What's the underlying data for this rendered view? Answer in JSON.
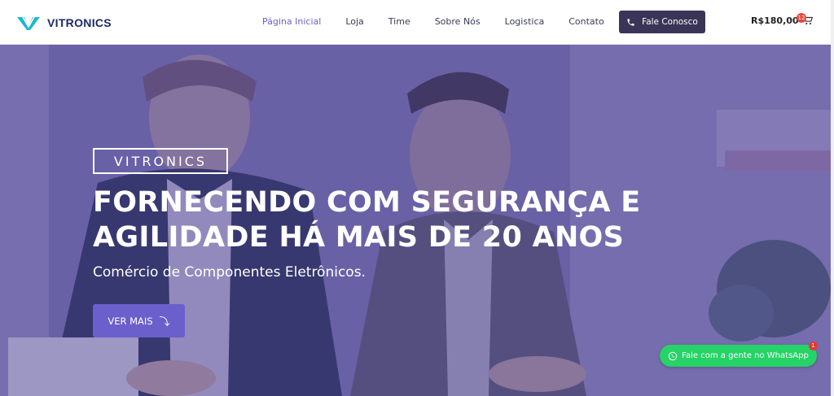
{
  "brand": {
    "name": "VITRONICS"
  },
  "nav": {
    "items": [
      {
        "label": "Página Inicial"
      },
      {
        "label": "Loja"
      },
      {
        "label": "Time"
      },
      {
        "label": "Sobre Nós"
      },
      {
        "label": "Logistica"
      },
      {
        "label": "Contato"
      }
    ],
    "active_index": 0
  },
  "header": {
    "cta_label": "Fale Conosco",
    "cart_amount": "R$180,00",
    "cart_count": "12"
  },
  "hero": {
    "tag": "VITRONICS",
    "headline": "FORNECENDO COM SEGURANÇA E AGILIDADE HÁ MAIS DE 20 ANOS",
    "subline": "Comércio de Componentes Eletrônicos.",
    "button_label": "VER MAIS"
  },
  "whatsapp": {
    "label": "Fale com a gente no WhatsApp",
    "badge_count": "1"
  },
  "colors": {
    "accent": "#6b5ec9",
    "cta_bg": "#3a3557",
    "brand_text": "#1a2a66",
    "whatsapp": "#25d366"
  },
  "icons": [
    "logo-mark-icon",
    "phone-icon",
    "cart-icon",
    "arrow-down-icon",
    "whatsapp-icon"
  ]
}
